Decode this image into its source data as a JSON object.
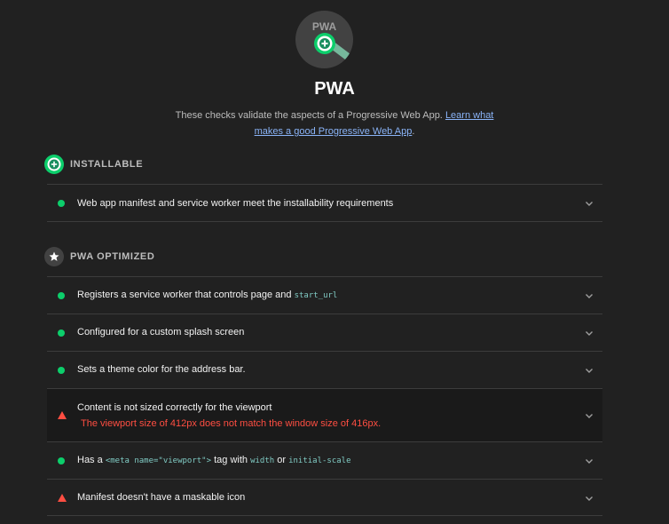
{
  "category": {
    "badge_text": "PWA",
    "title": "PWA",
    "description": "These checks validate the aspects of a Progressive Web App.",
    "link_text_1": "Learn what",
    "link_text_2": "makes a good Progressive Web App",
    "description_tail": "."
  },
  "groups": [
    {
      "title": "INSTALLABLE",
      "icon": "plus-circle-icon",
      "audits": [
        {
          "status": "pass",
          "label": "Web app manifest and service worker meet the installability requirements"
        }
      ]
    },
    {
      "title": "PWA OPTIMIZED",
      "icon": "star-icon",
      "audits": [
        {
          "status": "pass",
          "label": "Registers a service worker that controls page and",
          "code": "start_url"
        },
        {
          "status": "pass",
          "label": "Configured for a custom splash screen"
        },
        {
          "status": "pass",
          "label": "Sets a theme color for the address bar."
        },
        {
          "status": "fail",
          "label": "Content is not sized correctly for the viewport",
          "detail": "The viewport size of 412px does not match the window size of 416px."
        },
        {
          "status": "pass",
          "label_a": "Has a",
          "code_a": "<meta name=\"viewport\">",
          "label_b": "tag with",
          "code_b": "width",
          "label_c": "or",
          "code_c": "initial-scale"
        },
        {
          "status": "fail",
          "label": "Manifest doesn't have a maskable icon"
        }
      ]
    }
  ],
  "colors": {
    "background": "#212121",
    "pass": "#0cce6b",
    "fail": "#ff4e42",
    "link": "#8ab4f8",
    "code": "#80cbc4"
  }
}
